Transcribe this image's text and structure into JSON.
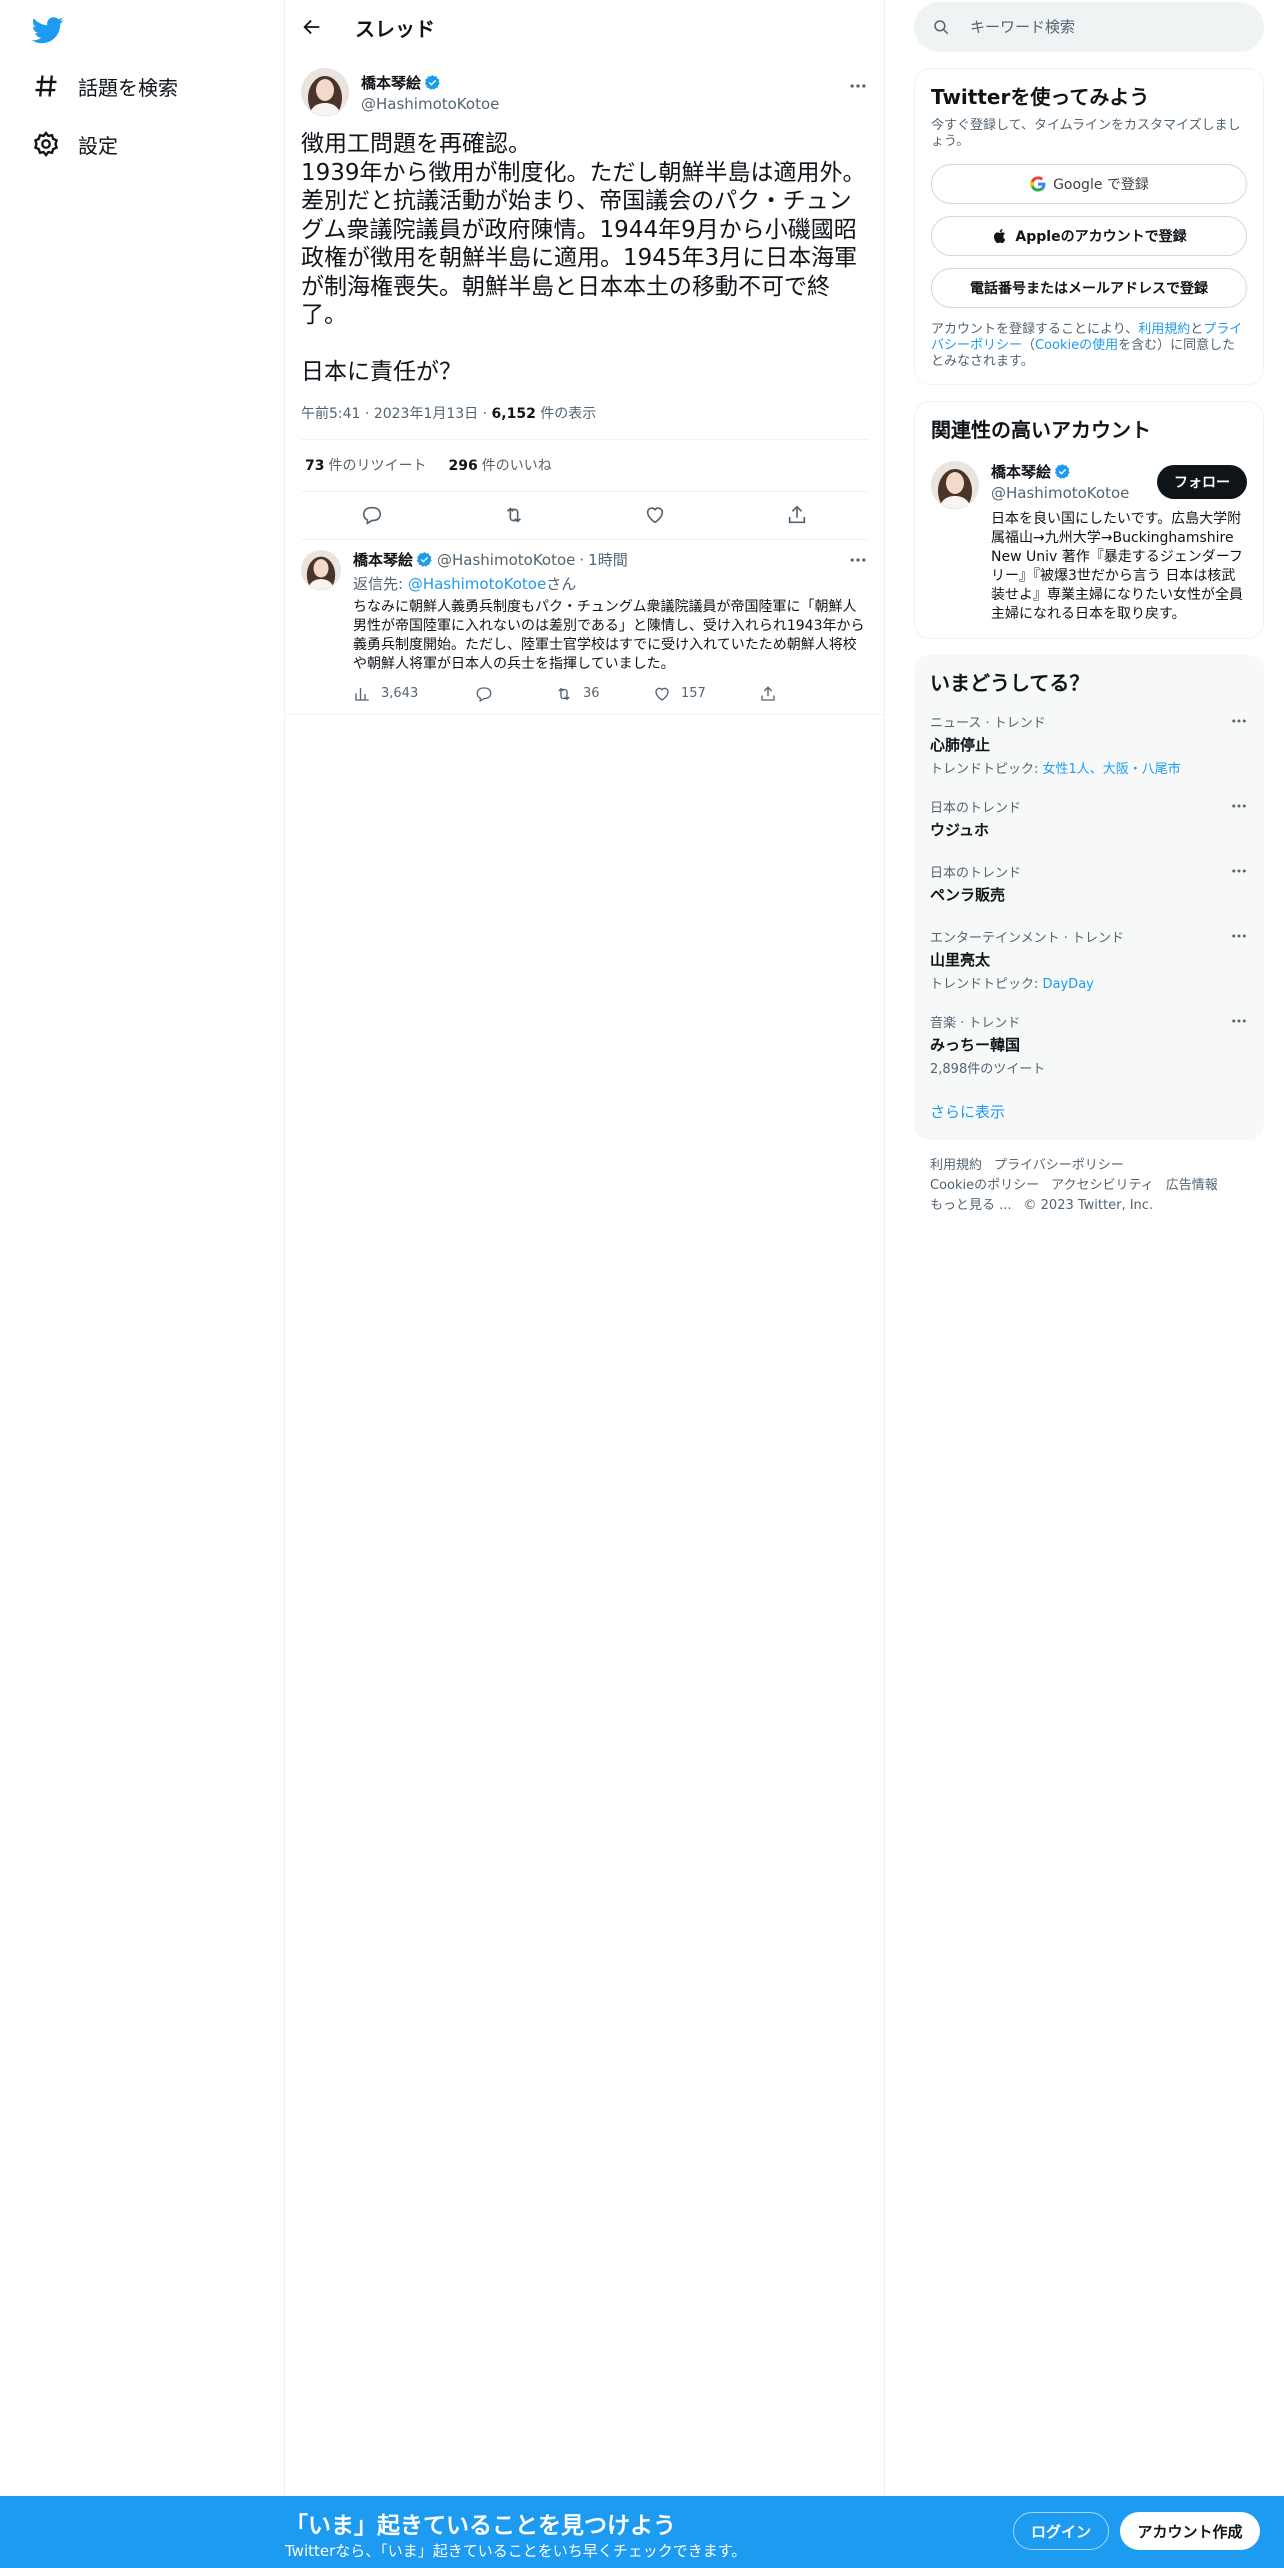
{
  "nav": {
    "items": [
      {
        "label": "話題を検索",
        "icon": "hashtag-icon"
      },
      {
        "label": "設定",
        "icon": "gear-icon"
      }
    ]
  },
  "header": {
    "title": "スレッド"
  },
  "tweet": {
    "name": "橋本琴絵",
    "handle": "@HashimotoKotoe",
    "text": "徴用工問題を再確認。\n1939年から徴用が制度化。ただし朝鮮半島は適用外。差別だと抗議活動が始まり、帝国議会のパク・チュングム衆議院議員が政府陳情。1944年9月から小磯國昭政権が徴用を朝鮮半島に適用。1945年3月に日本海軍が制海権喪失。朝鮮半島と日本本土の移動不可で終了。\n\n日本に責任が？",
    "time": "午前5:41",
    "date": "2023年1月13日",
    "views": "6,152",
    "views_label": "件の表示",
    "retweets": "73",
    "retweets_label": "件のリツイート",
    "likes": "296",
    "likes_label": "件のいいね"
  },
  "reply": {
    "name": "橋本琴絵",
    "handle": "@HashimotoKotoe",
    "time": "1時間",
    "reply_prefix": "返信先: ",
    "reply_to": "@HashimotoKotoe",
    "reply_suffix": "さん",
    "text": "ちなみに朝鮮人義勇兵制度もパク・チュングム衆議院議員が帝国陸軍に「朝鮮人男性が帝国陸軍に入れないのは差別である」と陳情し、受け入れられ1943年から義勇兵制度開始。ただし、陸軍士官学校はすでに受け入れていたため朝鮮人将校や朝鮮人将軍が日本人の兵士を指揮していました。",
    "views": "3,643",
    "retweets": "36",
    "likes": "157"
  },
  "search": {
    "placeholder": "キーワード検索"
  },
  "signup_card": {
    "title": "Twitterを使ってみよう",
    "subtitle": "今すぐ登録して、タイムラインをカスタマイズしましょう。",
    "google": "Google で登録",
    "apple": "Appleのアカウントで登録",
    "phone": "電話番号またはメールアドレスで登録",
    "legal_prefix": "アカウントを登録することにより、",
    "terms": "利用規約",
    "and": "と",
    "privacy": "プライバシーポリシー",
    "cookie_open": "（",
    "cookie": "Cookieの使用",
    "legal_suffix": "を含む）に同意したとみなされます。"
  },
  "related": {
    "title": "関連性の高いアカウント",
    "name": "橋本琴絵",
    "handle": "@HashimotoKotoe",
    "follow": "フォロー",
    "bio": "日本を良い国にしたいです。広島大学附属福山→九州大学→Buckinghamshire New Univ 著作『暴走するジェンダーフリー』『被爆3世だから言う 日本は核武装せよ』専業主婦になりたい女性が全員主婦になれる日本を取り戻す。"
  },
  "trends": {
    "title": "いまどうしてる？",
    "items": [
      {
        "category": "ニュース · トレンド",
        "name": "心肺停止",
        "extra_prefix": "トレンドトピック: ",
        "extra_link": "女性1人、大阪・八尾市"
      },
      {
        "category": "日本のトレンド",
        "name": "ウジュホ"
      },
      {
        "category": "日本のトレンド",
        "name": "ペンラ販売"
      },
      {
        "category": "エンターテインメント · トレンド",
        "name": "山里亮太",
        "extra_prefix": "トレンドトピック: ",
        "extra_link": "DayDay"
      },
      {
        "category": "音楽 · トレンド",
        "name": "みっちー韓国",
        "extra_text": "2,898件のツイート"
      }
    ],
    "show_more": "さらに表示"
  },
  "footer": {
    "links": [
      "利用規約",
      "プライバシーポリシー",
      "Cookieのポリシー",
      "アクセシビリティ",
      "広告情報",
      "もっと見る ..."
    ],
    "copyright": "© 2023 Twitter, Inc."
  },
  "bottom_bar": {
    "title": "「いま」起きていることを見つけよう",
    "subtitle": "Twitterなら、「いま」起きていることをいち早くチェックできます。",
    "login": "ログイン",
    "signup": "アカウント作成"
  },
  "colors": {
    "accent": "#1d9bf0",
    "text": "#0f1419",
    "muted": "#536471"
  }
}
